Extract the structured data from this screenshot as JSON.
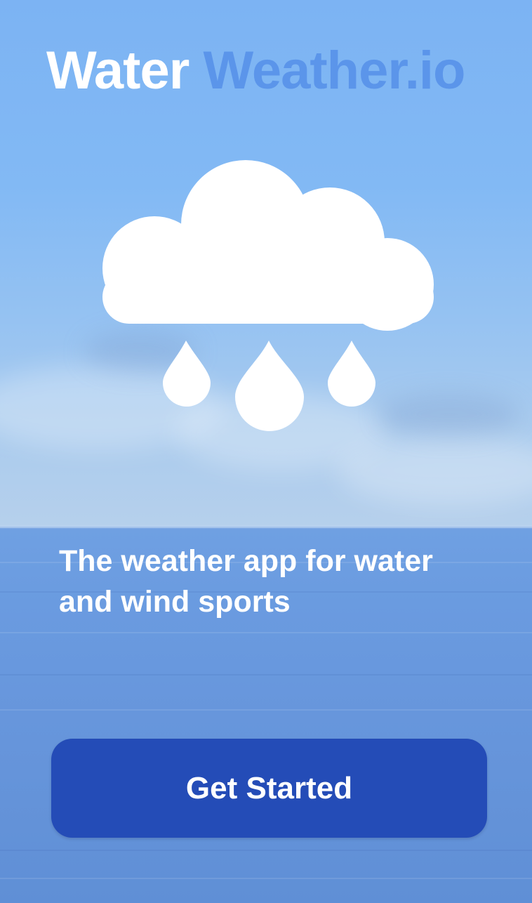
{
  "app": {
    "title_part1": "Water",
    "title_part2": "Weather.io"
  },
  "hero": {
    "icon": "cloud-rain-icon",
    "tagline": "The weather app for water and wind sports"
  },
  "actions": {
    "get_started_label": "Get Started"
  },
  "colors": {
    "accent_text": "#5b95ea",
    "button": "#244cb7",
    "text": "#ffffff"
  }
}
